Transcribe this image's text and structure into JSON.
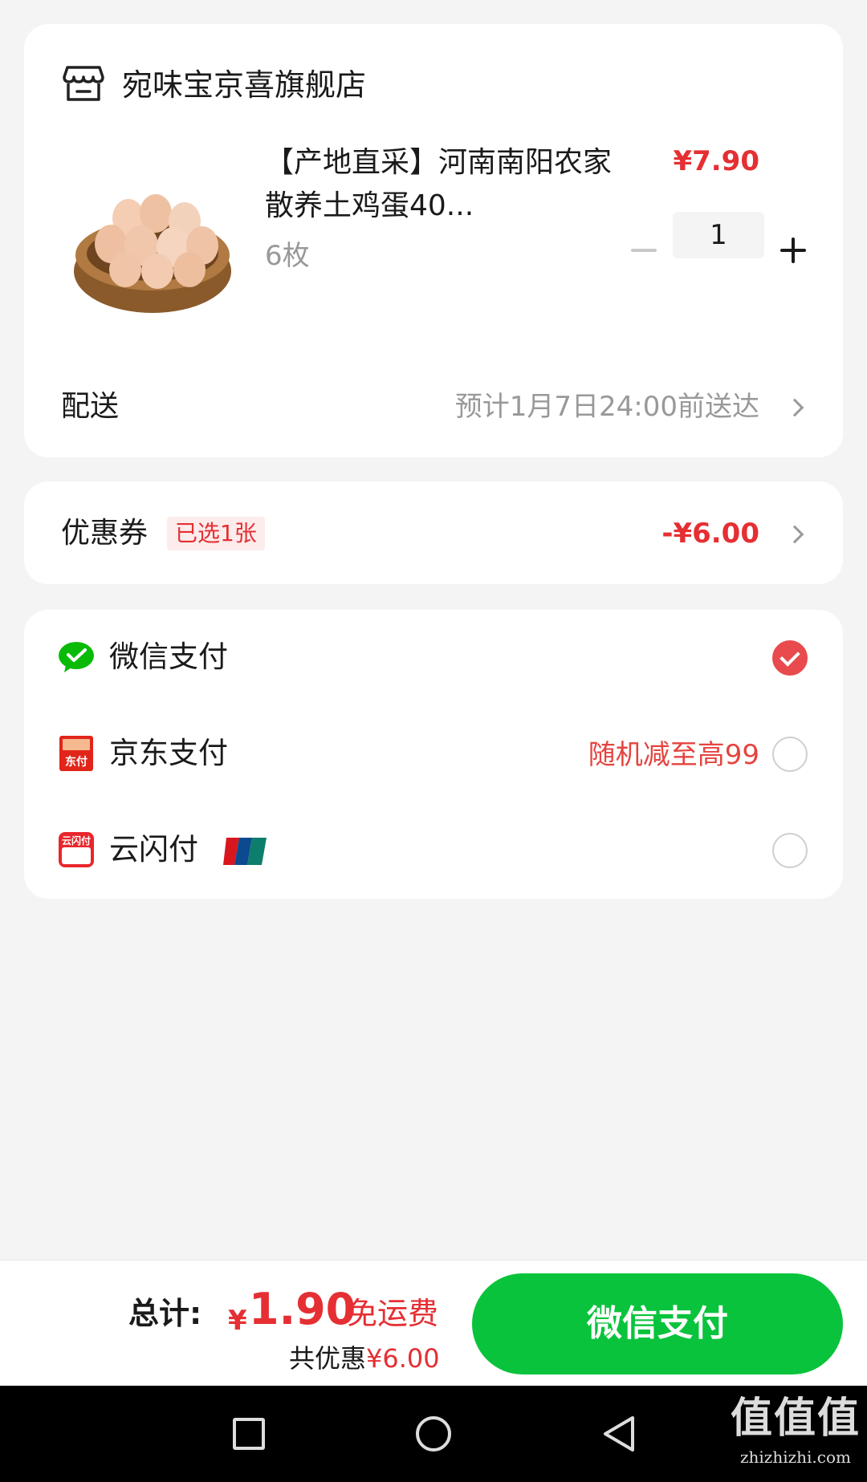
{
  "shop": {
    "name": "宛味宝京喜旗舰店",
    "icon": "store-icon"
  },
  "product": {
    "title": "【产地直采】河南南阳农家散养土鸡蛋40...",
    "spec": "6枚",
    "price": "¥7.90",
    "quantity": "1"
  },
  "delivery": {
    "label": "配送",
    "value": "预计1月7日24:00前送达"
  },
  "coupon": {
    "label": "优惠券",
    "badge": "已选1张",
    "value": "-¥6.00"
  },
  "payments": [
    {
      "label": "微信支付",
      "icon": "wechat-pay-icon",
      "selected": true,
      "promo": ""
    },
    {
      "label": "京东支付",
      "icon": "jd-pay-icon",
      "selected": false,
      "promo": "随机减至高99",
      "icon_text": "东付"
    },
    {
      "label": "云闪付",
      "icon": "quickpass-icon",
      "selected": false,
      "promo": "",
      "icon_text": "云闪付"
    }
  ],
  "summary": {
    "total_label": "总计:",
    "currency": "¥",
    "total_amount": "1.90",
    "shipping": "免运费",
    "saving_label": "共优惠",
    "saving_amount": "¥6.00",
    "pay_button": "微信支付"
  },
  "watermark": {
    "big": "值值值",
    "small": "zhizhizhi.com"
  },
  "colors": {
    "accent_red": "#e52f33",
    "wechat_green": "#0ac33c"
  }
}
